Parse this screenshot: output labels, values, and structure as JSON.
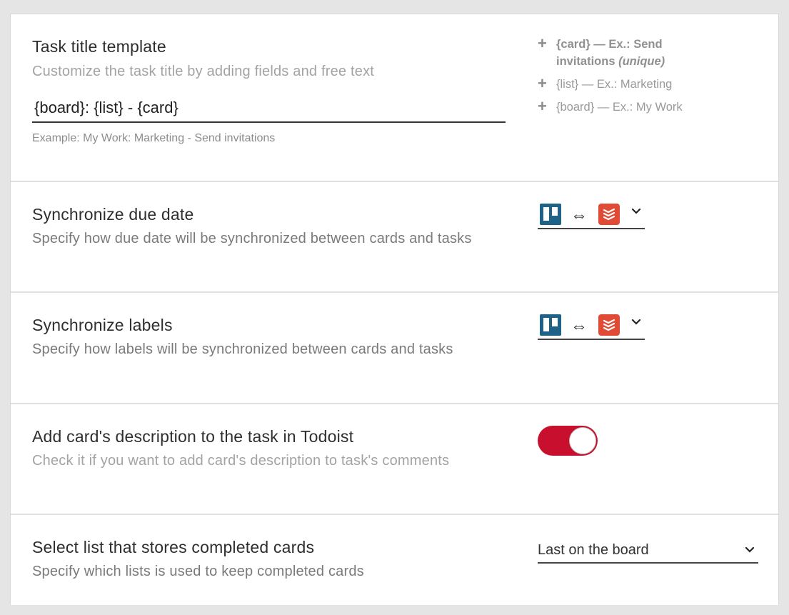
{
  "title_template": {
    "title": "Task title template",
    "description": "Customize the task title by adding fields and free text",
    "input_value": "{board}: {list} - {card}",
    "example": "Example: My Work: Marketing - Send invitations",
    "fields": [
      {
        "label": "{card} — Ex.: Send invitations",
        "unique": "(unique)"
      },
      {
        "label": "{list} — Ex.: Marketing"
      },
      {
        "label": "{board} — Ex.: My Work"
      }
    ],
    "plus_icon": "+"
  },
  "due_date": {
    "title": "Synchronize due date",
    "description": "Specify how due date will be synchronized between cards and tasks",
    "arrow": "⇔"
  },
  "labels": {
    "title": "Synchronize labels",
    "description": "Specify how labels will be synchronized between cards and tasks",
    "arrow": "⇔"
  },
  "description_sync": {
    "title": "Add card's description to the task in Todoist",
    "description": "Check it if you want to add card's description to task's comments",
    "enabled": true
  },
  "completed_list": {
    "title": "Select list that stores completed cards",
    "description": "Specify which lists is used to keep completed cards",
    "selected": "Last on the board"
  },
  "colors": {
    "trello": "#1f6287",
    "todoist": "#e14a34",
    "toggle_on": "#c8102e"
  },
  "icons": [
    "plus-icon",
    "trello-icon",
    "bidirectional-arrow-icon",
    "todoist-icon",
    "chevron-down-icon"
  ]
}
